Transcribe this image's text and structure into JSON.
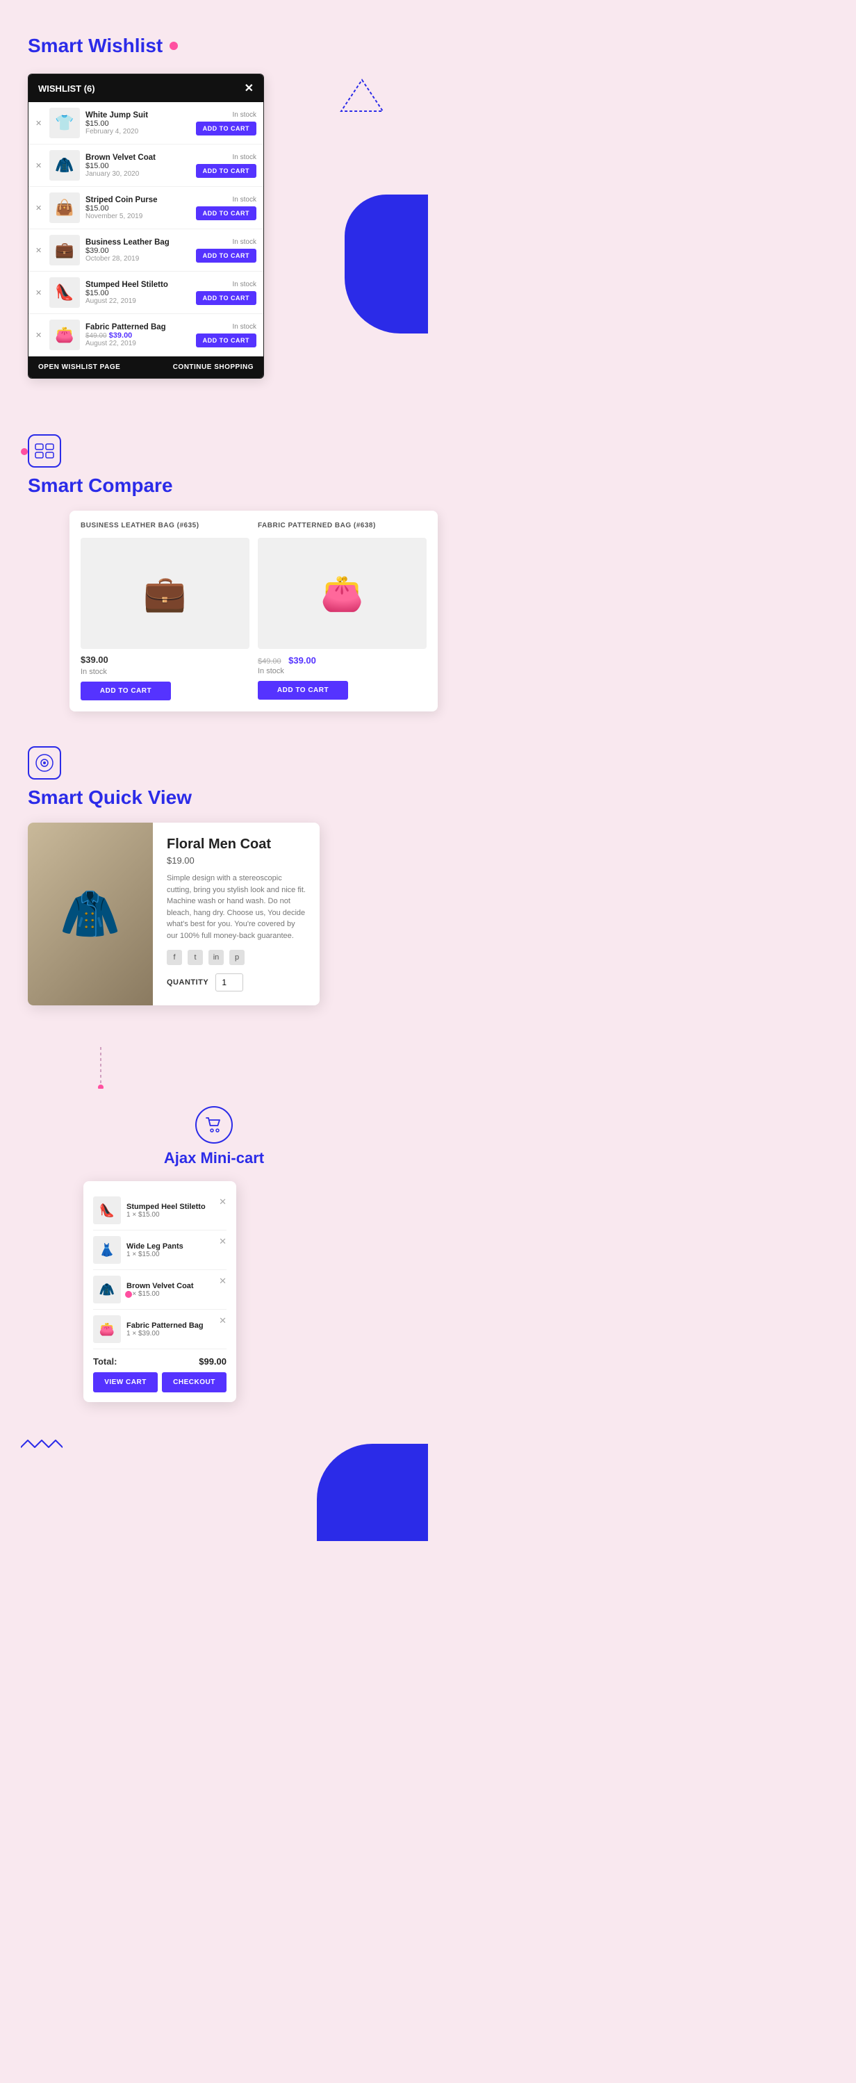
{
  "app": {
    "background_color": "#f9e8ef"
  },
  "wishlist_section": {
    "title": "Smart Wishlist",
    "panel_title": "WISHLIST (6)",
    "items": [
      {
        "id": 1,
        "name": "White Jump Suit",
        "price": "$15.00",
        "date": "February 4, 2020",
        "status": "In stock",
        "emoji": "👕"
      },
      {
        "id": 2,
        "name": "Brown Velvet Coat",
        "price": "$15.00",
        "date": "January 30, 2020",
        "status": "In stock",
        "emoji": "🧥"
      },
      {
        "id": 3,
        "name": "Striped Coin Purse",
        "price": "$15.00",
        "date": "November 5, 2019",
        "status": "In stock",
        "emoji": "👜"
      },
      {
        "id": 4,
        "name": "Business Leather Bag",
        "price": "$39.00",
        "date": "October 28, 2019",
        "status": "In stock",
        "emoji": "💼"
      },
      {
        "id": 5,
        "name": "Stumped Heel Stiletto",
        "price": "$15.00",
        "date": "August 22, 2019",
        "status": "In stock",
        "emoji": "👠"
      },
      {
        "id": 6,
        "name": "Fabric Patterned Bag",
        "price_old": "$49.00",
        "price": "$39.00",
        "date": "August 22, 2019",
        "status": "In stock",
        "emoji": "👛"
      }
    ],
    "btn_add_to_cart": "ADD TO CART",
    "footer_open": "OPEN WISHLIST PAGE",
    "footer_continue": "CONTINUE SHOPPING"
  },
  "compare_section": {
    "title": "Smart Compare",
    "products": [
      {
        "id": "635",
        "title": "BUSINESS LEATHER BAG (#635)",
        "price": "$39.00",
        "price_old": null,
        "price_new": null,
        "status": "In stock",
        "emoji": "💼",
        "btn": "ADD TO CART"
      },
      {
        "id": "638",
        "title": "FABRIC PATTERNED BAG (#638)",
        "price": null,
        "price_old": "$49.00",
        "price_new": "$39.00",
        "status": "In stock",
        "emoji": "👛",
        "btn": "ADD TO CART"
      }
    ]
  },
  "quickview_section": {
    "title": "Smart Quick View",
    "product": {
      "name": "Floral Men Coat",
      "price": "$19.00",
      "description": "Simple design with a stereoscopic cutting, bring you stylish look and nice fit. Machine wash or hand wash. Do not bleach, hang dry. Choose us, You decide what's best for you. You're covered by our 100% full money-back guarantee.",
      "quantity": 1,
      "emoji": "🧥"
    }
  },
  "minicart_section": {
    "title": "Ajax Mini-cart",
    "items": [
      {
        "name": "Stumped Heel Stiletto",
        "qty": 1,
        "price": "$15.00",
        "emoji": "👠"
      },
      {
        "name": "Wide Leg Pants",
        "qty": 1,
        "price": "$15.00",
        "emoji": "👗"
      },
      {
        "name": "Brown Velvet Coat",
        "qty": 2,
        "price": "$15.00",
        "emoji": "🧥"
      },
      {
        "name": "Fabric Patterned Bag",
        "qty": 1,
        "price": "$39.00",
        "emoji": "👛"
      }
    ],
    "total_label": "Total:",
    "total_amount": "$99.00",
    "btn_view_cart": "VIEW CART",
    "btn_checkout": "CHECKOUT"
  }
}
